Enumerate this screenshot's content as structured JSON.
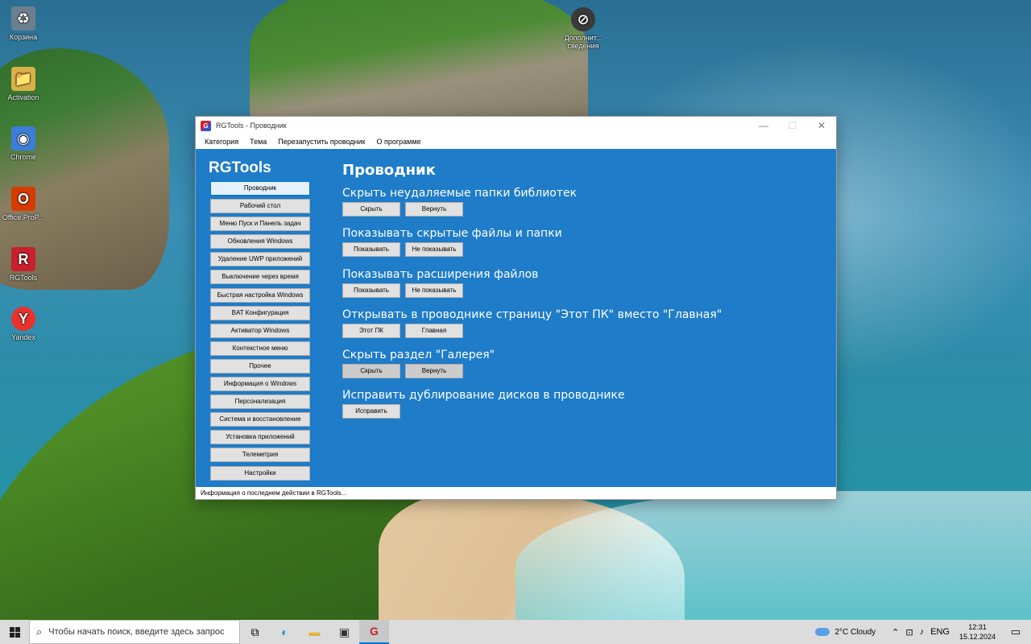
{
  "desktop": {
    "icons": [
      {
        "label": "Корзина",
        "glyph": "♻",
        "color": "#6b7f8f"
      },
      {
        "label": "Activation",
        "glyph": "📁",
        "color": "#d9b04a"
      },
      {
        "label": "Chrome",
        "glyph": "◉",
        "color": "#3b7dd8"
      },
      {
        "label": "Office.ProP...",
        "glyph": "O",
        "color": "#d83b01"
      },
      {
        "label": "RGTools",
        "glyph": "R",
        "color": "#c8202c"
      },
      {
        "label": "Yandex",
        "glyph": "Y",
        "color": "#e8322b"
      },
      {
        "label": "Дополнит... сведения",
        "glyph": "⊘",
        "color": "#3a3a3a"
      }
    ]
  },
  "window": {
    "title": "RGTools - Проводник",
    "icon": "rgtools-app-icon",
    "controls": {
      "minimize": "—",
      "maximize": "☐",
      "close": "✕"
    },
    "menu": [
      "Категория",
      "Тема",
      "Перезапустить проводник",
      "О программе"
    ],
    "brand": "RGTools",
    "nav": [
      "Проводник",
      "Рабочий стол",
      "Меню Пуск и Панель задач",
      "Обновления Windows",
      "Удаление UWP приложений",
      "Выключение через время",
      "Быстрая настройка Windows",
      "BAT Конфигурация",
      "Активатор Windows",
      "Контекстное меню",
      "Прочее",
      "Информация о Windows",
      "Персонализация",
      "Система и восстановление",
      "Установка приложений",
      "Телеметрия",
      "Настройки"
    ],
    "active_nav": 0,
    "page_title": "Проводник",
    "settings": [
      {
        "title": "Скрыть неудаляемые папки библиотек",
        "buttons": [
          "Скрыть",
          "Вернуть"
        ]
      },
      {
        "title": "Показывать скрытые файлы и папки",
        "buttons": [
          "Показывать",
          "Не показывать"
        ]
      },
      {
        "title": "Показывать расширения файлов",
        "buttons": [
          "Показывать",
          "Не показывать"
        ]
      },
      {
        "title": "Открывать в проводнике страницу \"Этот ПК\" вместо \"Главная\"",
        "buttons": [
          "Этот ПК",
          "Главная"
        ]
      },
      {
        "title": "Скрыть раздел \"Галерея\"",
        "buttons": [
          "Скрыть",
          "Вернуть"
        ]
      },
      {
        "title": "Исправить дублирование дисков в проводнике",
        "buttons": [
          "Исправить"
        ]
      }
    ],
    "status": "Информация о последнем действии в RGTools...",
    "colors": {
      "content_bg": "#1e7cc8",
      "button_bg": "#e1e1e1"
    }
  },
  "taskbar": {
    "search_placeholder": "Чтобы начать поиск, введите здесь запрос",
    "apps": [
      {
        "name": "task-view-icon",
        "glyph": "⧉"
      },
      {
        "name": "edge-icon",
        "glyph": "◐"
      },
      {
        "name": "file-explorer-icon",
        "glyph": "▬"
      },
      {
        "name": "store-icon",
        "glyph": "▣"
      },
      {
        "name": "rgtools-taskbar-icon",
        "glyph": "G"
      }
    ],
    "weather": "2°C  Cloudy",
    "lang": "ENG",
    "time": "12:31",
    "date": "15.12.2024"
  }
}
